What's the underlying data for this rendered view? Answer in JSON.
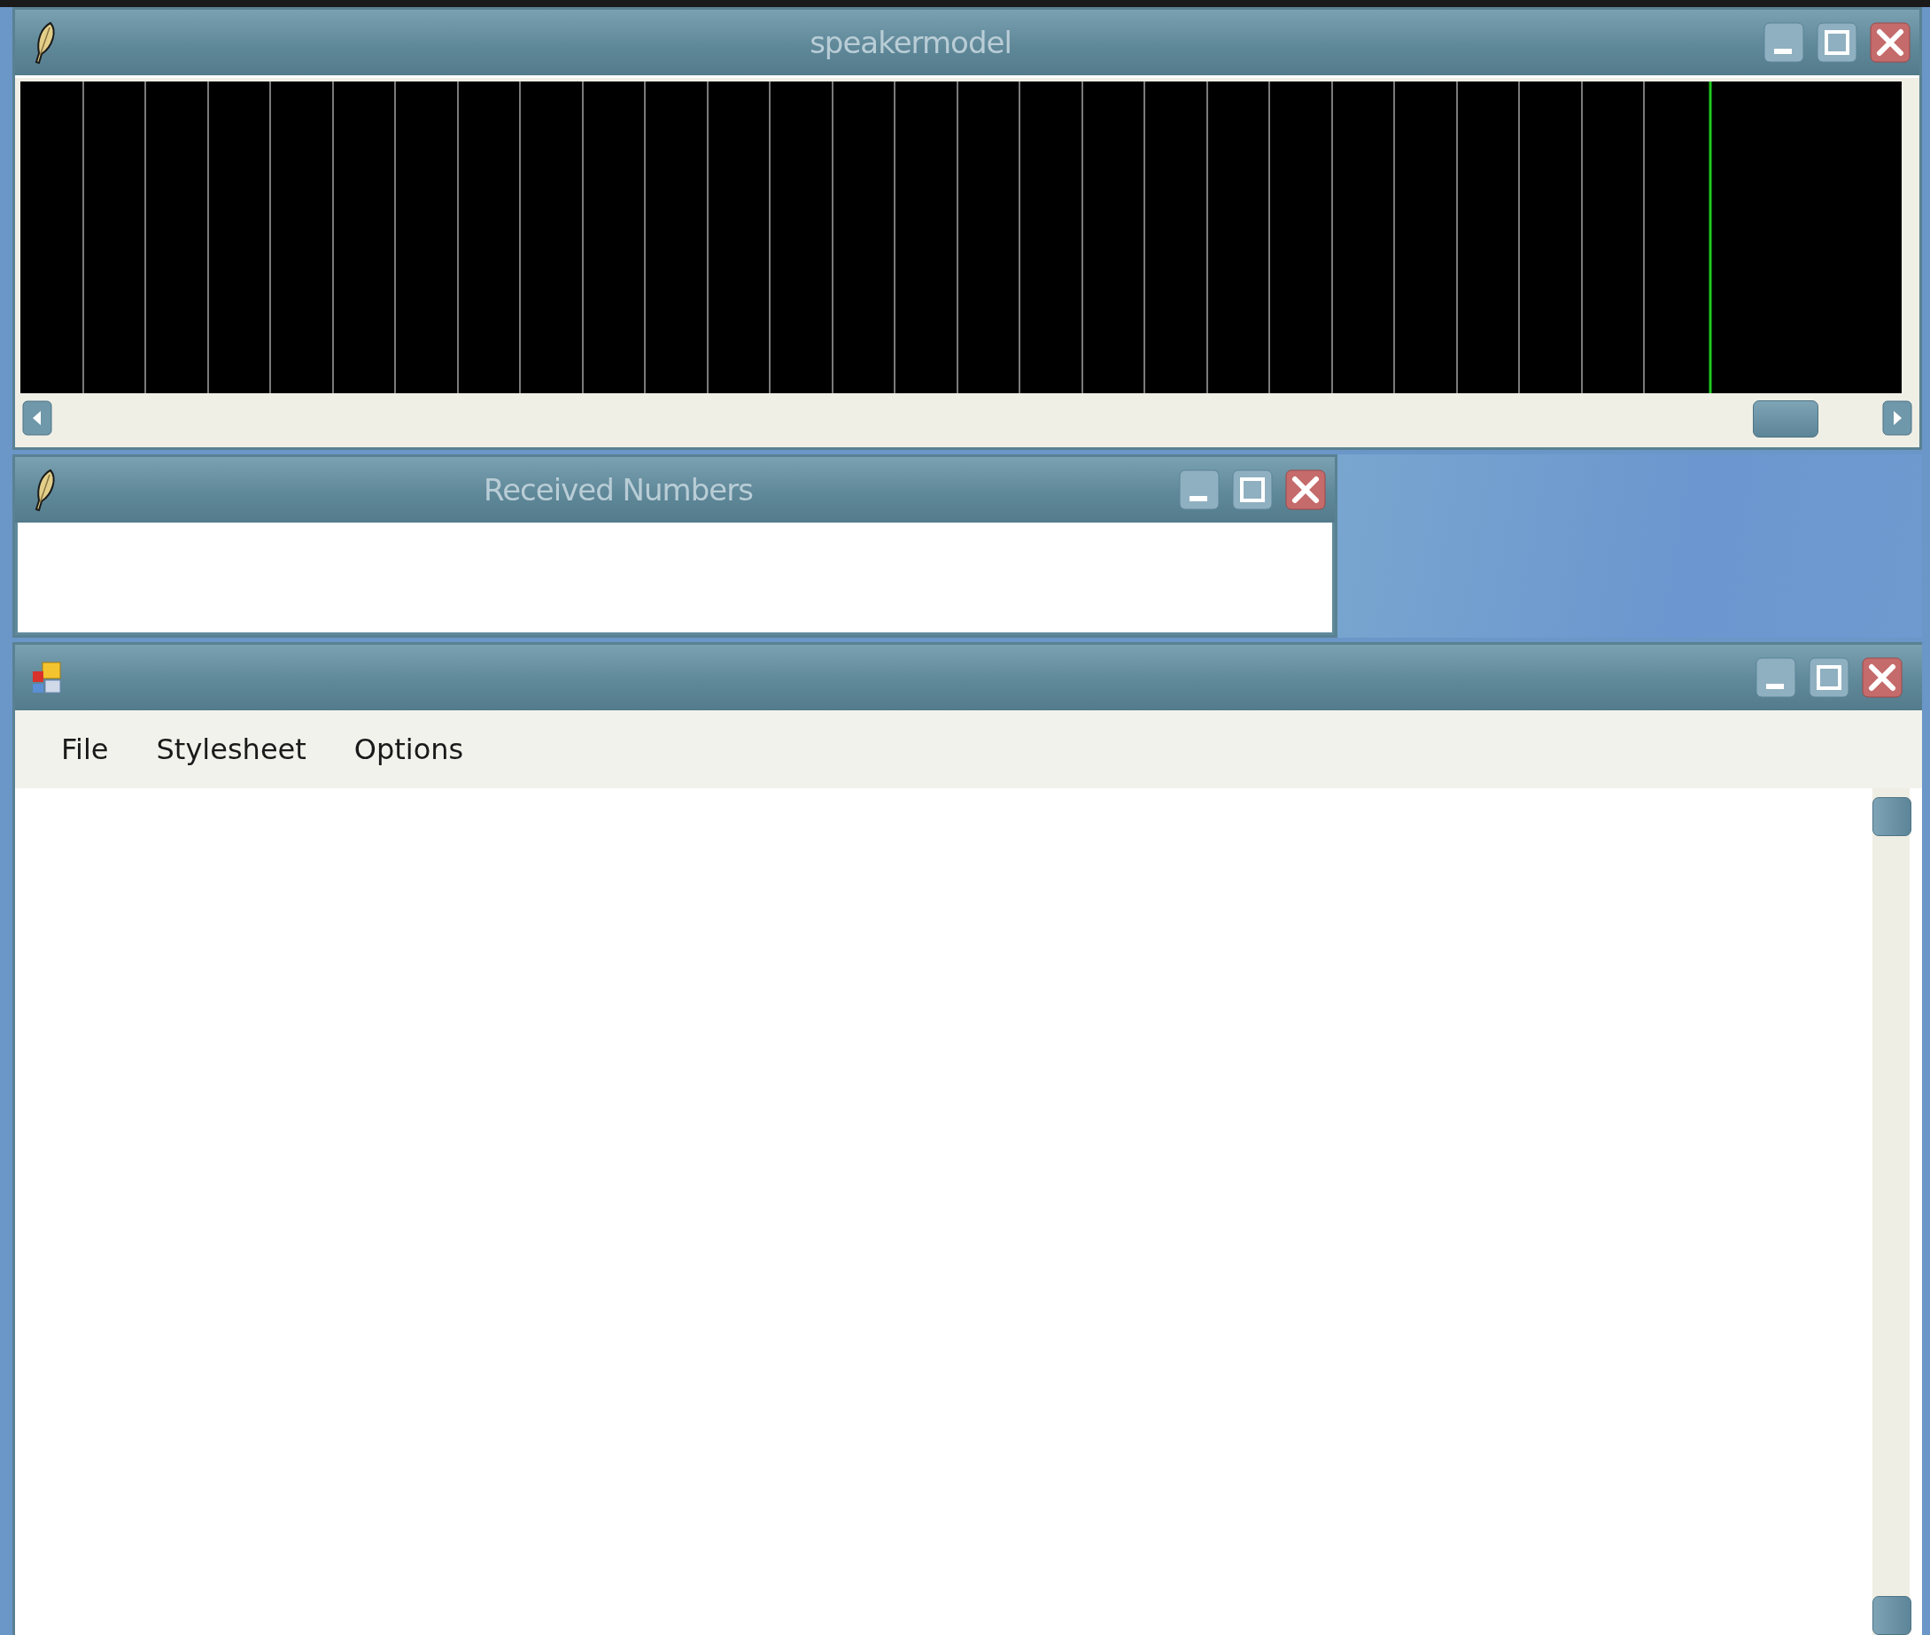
{
  "windows": [
    {
      "kind": "plot",
      "title": "speakermodel"
    },
    {
      "kind": "list",
      "title": "Received Numbers"
    },
    {
      "kind": "editor",
      "menu": [
        "File",
        "Stylesheet",
        "Options"
      ]
    }
  ]
}
